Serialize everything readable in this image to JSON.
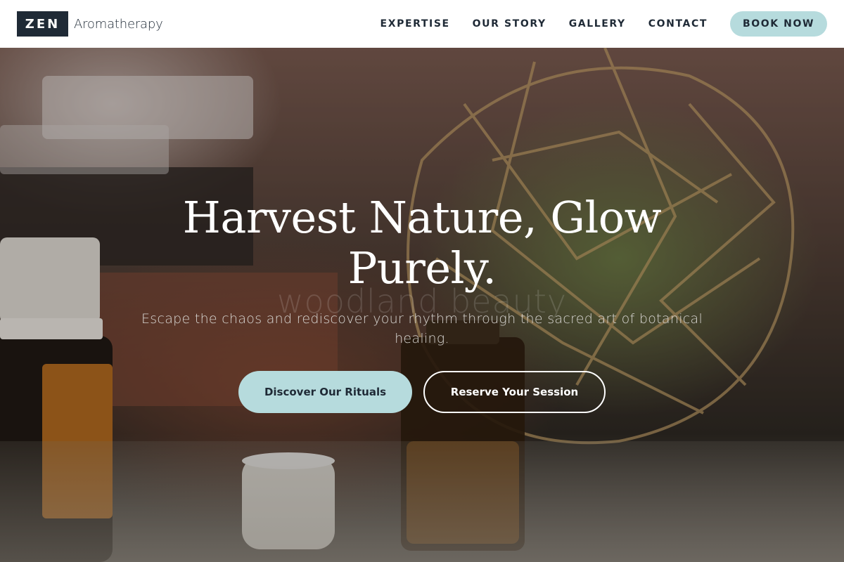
{
  "header": {
    "brand_mark": "ZEN",
    "brand_name": "Aromatherapy",
    "nav": [
      {
        "label": "EXPERTISE"
      },
      {
        "label": "OUR STORY"
      },
      {
        "label": "GALLERY"
      },
      {
        "label": "CONTACT"
      }
    ],
    "cta_label": "BOOK NOW"
  },
  "hero": {
    "title": "Harvest Nature, Glow Purely.",
    "watermark": "woodland beauty",
    "subtitle": "Escape the chaos and rediscover your rhythm through the sacred art of botanical healing.",
    "primary_button": "Discover Our Rituals",
    "secondary_button": "Reserve Your Session"
  },
  "colors": {
    "brand_dark": "#1f2a36",
    "accent": "#b6dbdd",
    "white": "#ffffff"
  }
}
